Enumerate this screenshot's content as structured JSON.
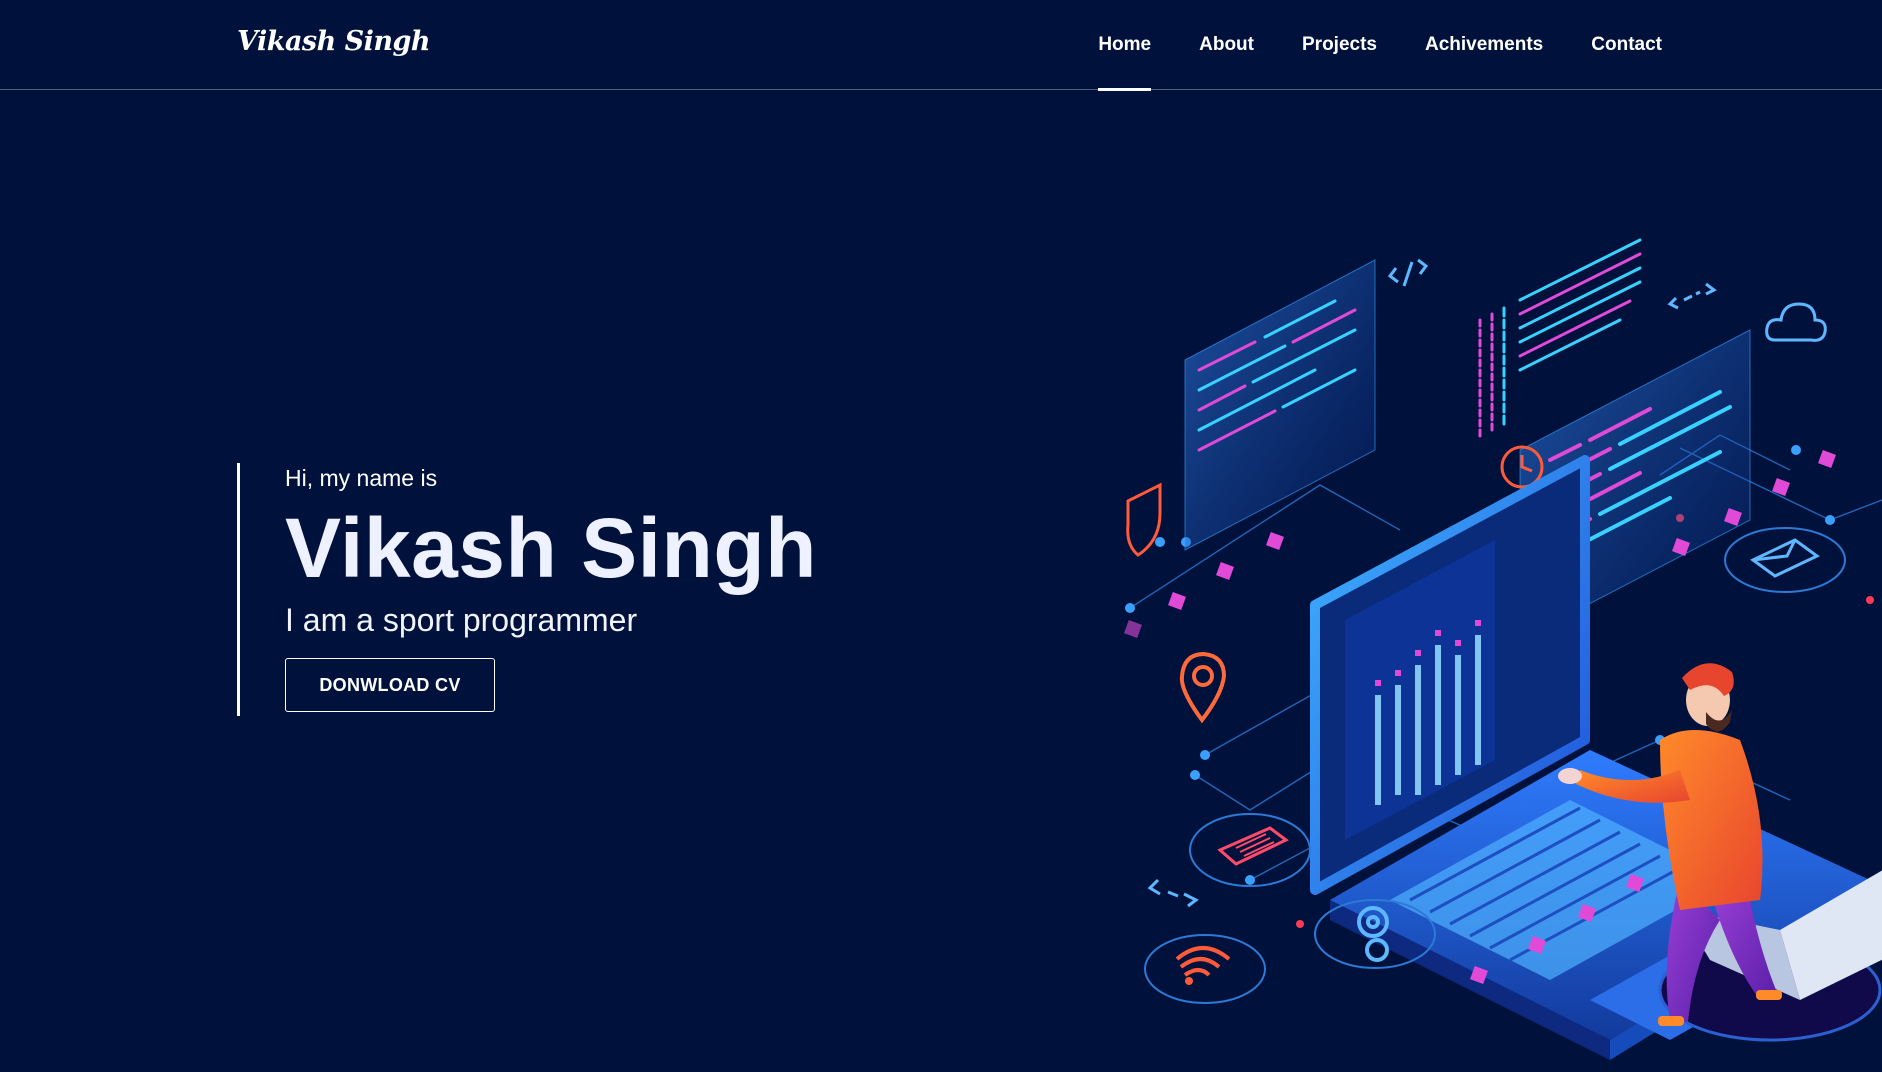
{
  "brand": {
    "logo": "Vikash Singh"
  },
  "nav": {
    "items": [
      {
        "label": "Home",
        "active": true
      },
      {
        "label": "About",
        "active": false
      },
      {
        "label": "Projects",
        "active": false
      },
      {
        "label": "Achivements",
        "active": false
      },
      {
        "label": "Contact",
        "active": false
      }
    ]
  },
  "hero": {
    "greeting": "Hi, my name is",
    "name": "Vikash Singh",
    "subtitle": "I am a sport programmer",
    "cta_label": "DONWLOAD CV"
  },
  "illustration": {
    "subject": "isometric laptop with programmer and floating code screens",
    "icons": [
      "code-tag-icon",
      "cloud-icon",
      "shield-icon",
      "clock-icon",
      "envelope-icon",
      "location-pin-icon",
      "document-icon",
      "gear-icon",
      "wifi-icon",
      "arrows-icon"
    ]
  },
  "colors": {
    "background": "#00123c",
    "text": "#ffffff",
    "accent_blue": "#3aa0ff",
    "accent_pink": "#e04ad6",
    "accent_orange": "#f07a2a"
  }
}
